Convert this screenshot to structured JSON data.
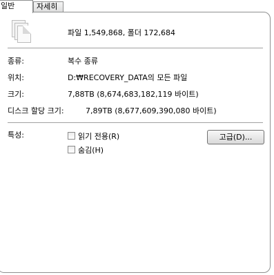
{
  "tabs": [
    {
      "label": "일반"
    },
    {
      "label": "자세히"
    }
  ],
  "summary": {
    "icon": "multiple-files-icon",
    "text": "파일 1,549,868, 폴더 172,684"
  },
  "fields": {
    "type_label": "종류:",
    "type_value": "복수 종류",
    "location_label": "위치:",
    "location_value": "D:₩RECOVERY_DATA의 모든 파일",
    "size_label": "크기:",
    "size_value": "7,88TB (8,674,683,182,119 바이트)",
    "disk_label": "디스크 할당 크기:",
    "disk_value": "7,89TB (8,677,609,390,080 바이트)"
  },
  "attributes": {
    "label": "특성:",
    "readonly_label": "읽기 전용(R)",
    "readonly_checked": false,
    "hidden_label": "숨김(H)",
    "hidden_checked": false,
    "advanced_button": "고급(D)..."
  }
}
